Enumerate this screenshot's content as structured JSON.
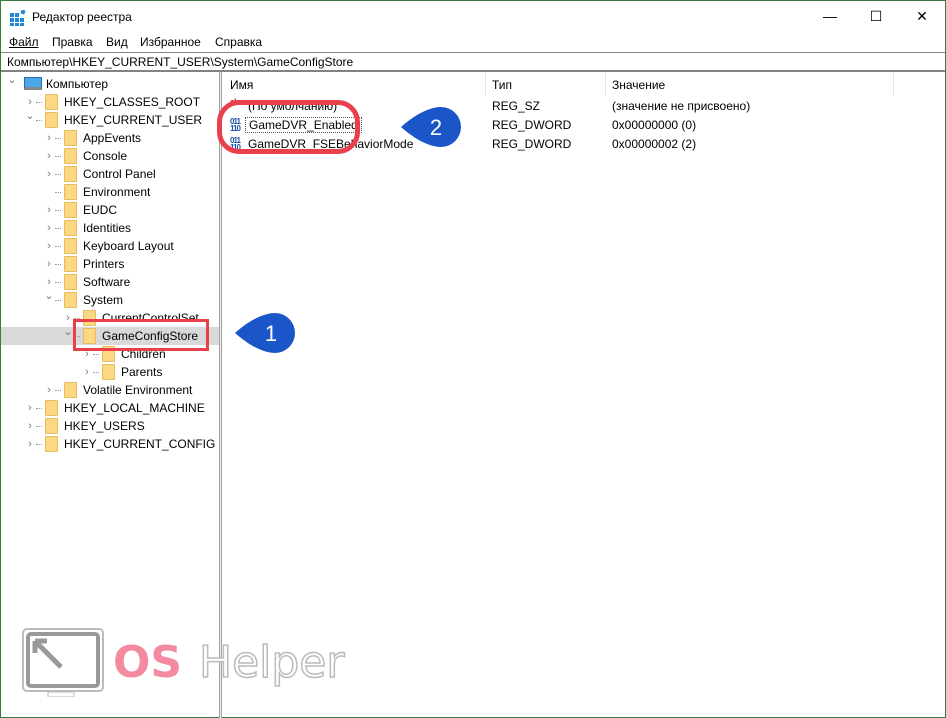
{
  "window": {
    "title": "Редактор реестра",
    "minimize": "—",
    "maximize": "☐",
    "close": "✕",
    "border_color": "#3c7a3c"
  },
  "menu": [
    {
      "label": "Файл"
    },
    {
      "label": "Правка"
    },
    {
      "label": "Вид"
    },
    {
      "label": "Избранное"
    },
    {
      "label": "Справка"
    }
  ],
  "address": "Компьютер\\HKEY_CURRENT_USER\\System\\GameConfigStore",
  "tree": [
    {
      "label": "Компьютер",
      "level": 0,
      "state": "expanded",
      "icon": "computer-icon"
    },
    {
      "label": "HKEY_CLASSES_ROOT",
      "level": 1,
      "state": "collapsed"
    },
    {
      "label": "HKEY_CURRENT_USER",
      "level": 1,
      "state": "expanded"
    },
    {
      "label": "AppEvents",
      "level": 2,
      "state": "collapsed"
    },
    {
      "label": "Console",
      "level": 2,
      "state": "collapsed"
    },
    {
      "label": "Control Panel",
      "level": 2,
      "state": "collapsed"
    },
    {
      "label": "Environment",
      "level": 2,
      "state": "leaf"
    },
    {
      "label": "EUDC",
      "level": 2,
      "state": "collapsed"
    },
    {
      "label": "Identities",
      "level": 2,
      "state": "collapsed"
    },
    {
      "label": "Keyboard Layout",
      "level": 2,
      "state": "collapsed"
    },
    {
      "label": "Printers",
      "level": 2,
      "state": "collapsed"
    },
    {
      "label": "Software",
      "level": 2,
      "state": "collapsed"
    },
    {
      "label": "System",
      "level": 2,
      "state": "expanded"
    },
    {
      "label": "CurrentControlSet",
      "level": 3,
      "state": "collapsed"
    },
    {
      "label": "GameConfigStore",
      "level": 3,
      "state": "expanded",
      "selected": true
    },
    {
      "label": "Children",
      "level": 4,
      "state": "collapsed"
    },
    {
      "label": "Parents",
      "level": 4,
      "state": "collapsed"
    },
    {
      "label": "Volatile Environment",
      "level": 2,
      "state": "collapsed"
    },
    {
      "label": "HKEY_LOCAL_MACHINE",
      "level": 1,
      "state": "collapsed"
    },
    {
      "label": "HKEY_USERS",
      "level": 1,
      "state": "collapsed"
    },
    {
      "label": "HKEY_CURRENT_CONFIG",
      "level": 1,
      "state": "collapsed"
    }
  ],
  "columns": {
    "name": "Имя",
    "type": "Тип",
    "value": "Значение"
  },
  "values": [
    {
      "name": "(По умолчанию)",
      "type": "REG_SZ",
      "data": "(значение не присвоено)",
      "icon": "string-value-icon"
    },
    {
      "name": "GameDVR_Enabled",
      "type": "REG_DWORD",
      "data": "0x00000000 (0)",
      "icon": "dword-value-icon",
      "focused": true
    },
    {
      "name": "GameDVR_FSEBehaviorMode",
      "type": "REG_DWORD",
      "data": "0x00000002 (2)",
      "icon": "dword-value-icon"
    }
  ],
  "annotations": {
    "step1": "1",
    "step2": "2",
    "callout_color": "#1a56c8",
    "highlight_color": "#e9414b"
  },
  "watermark": {
    "text_os": "OS",
    "text_helper": "Helper"
  }
}
